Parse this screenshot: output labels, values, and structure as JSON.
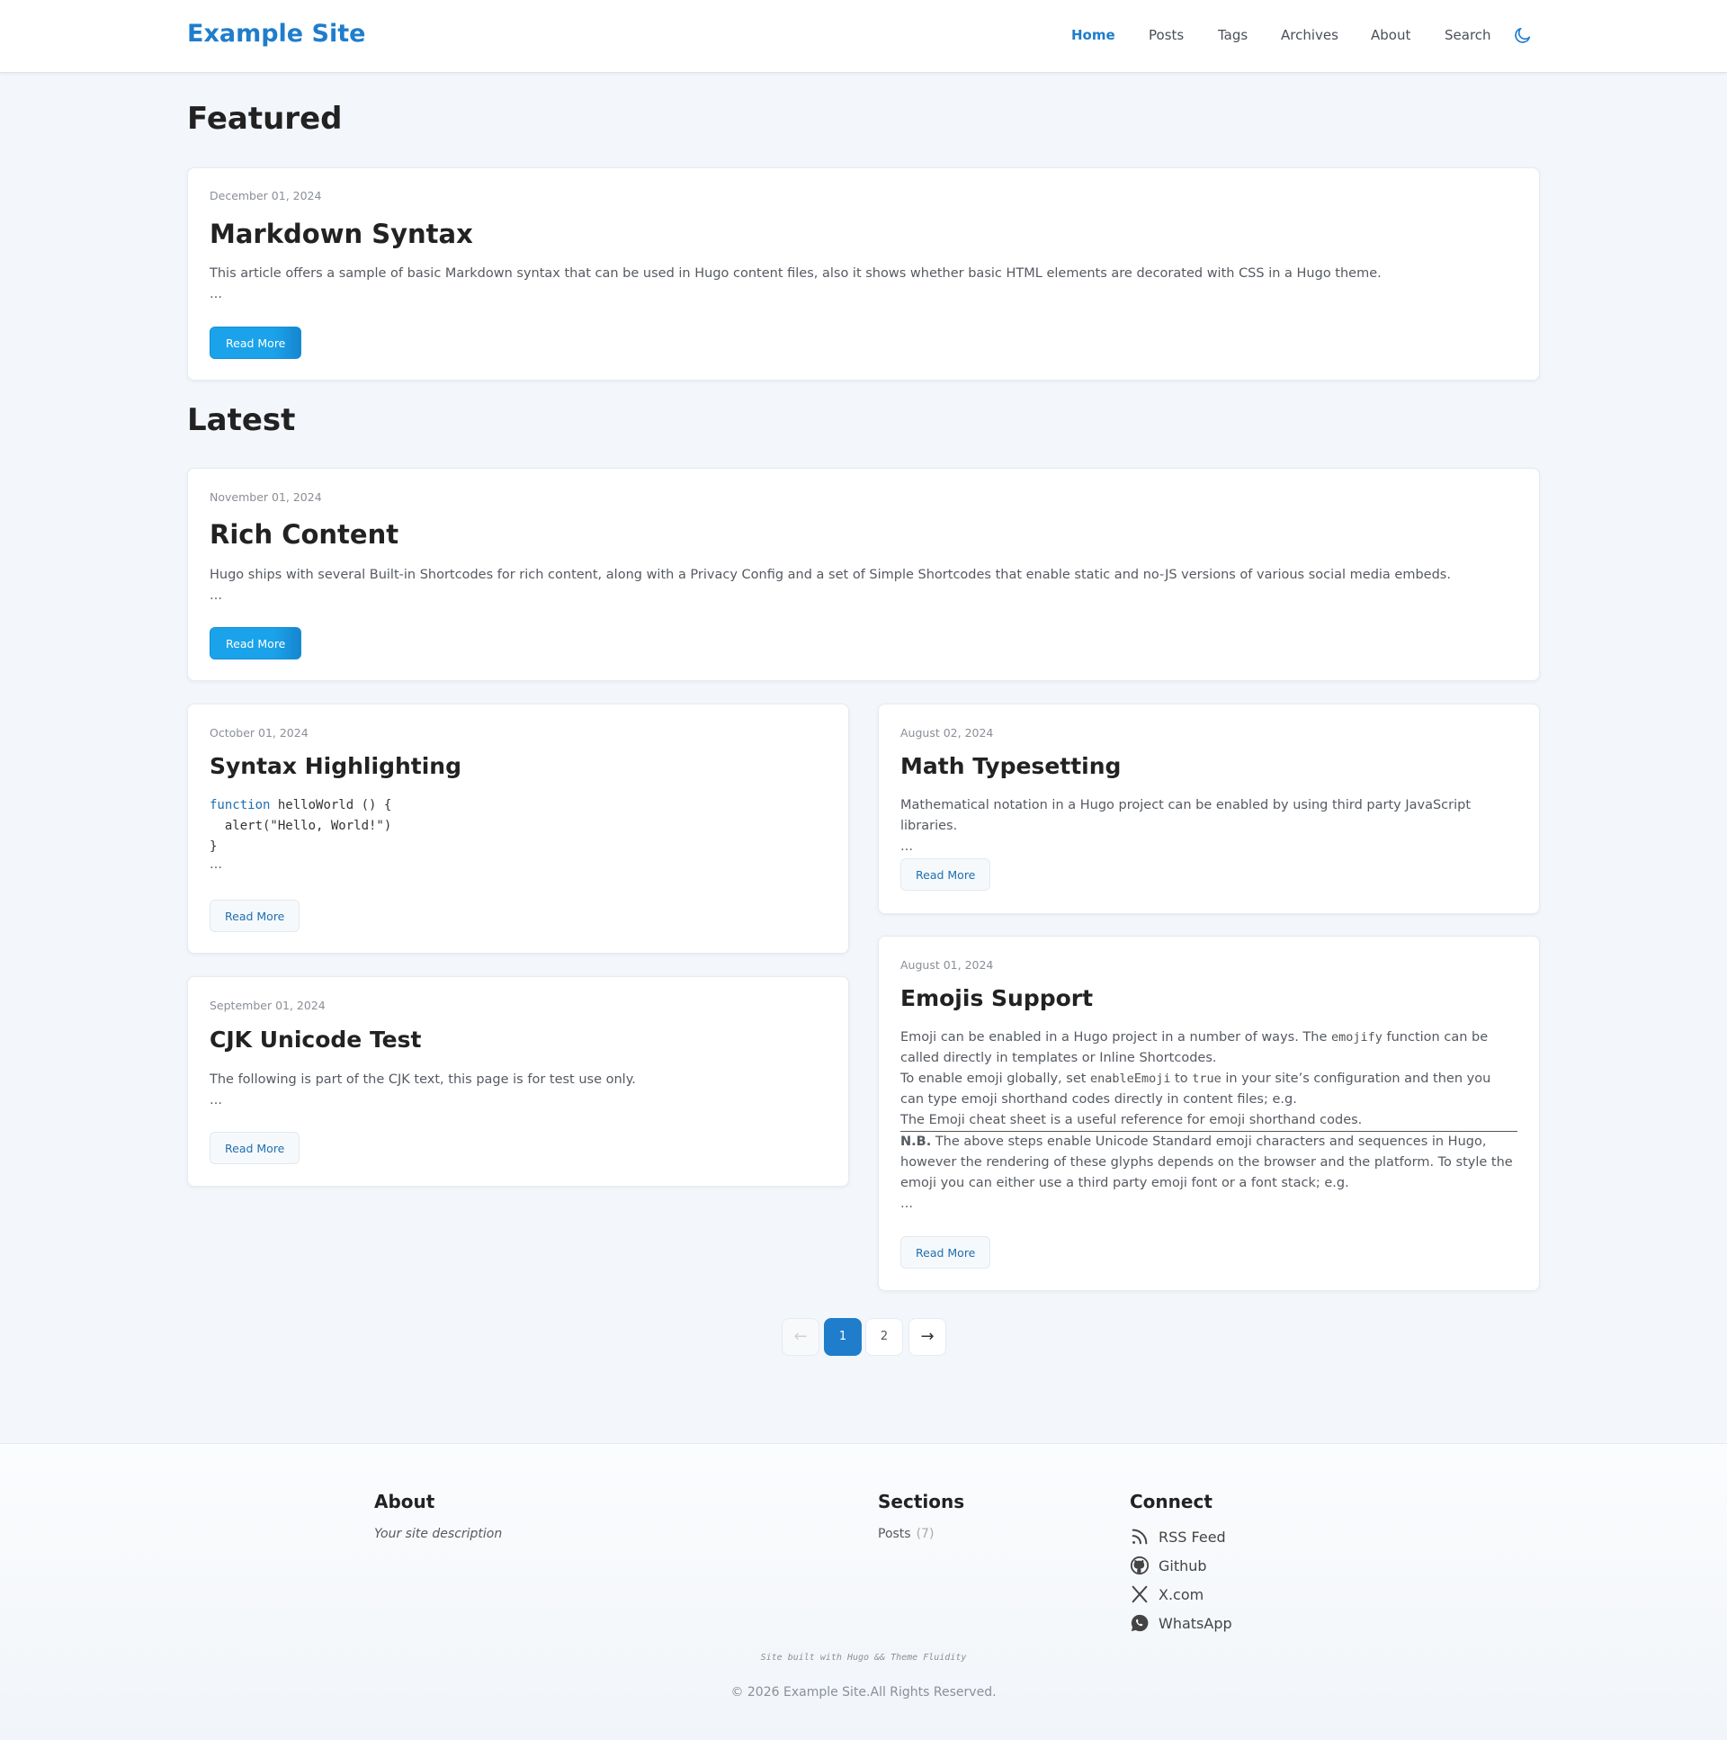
{
  "site": {
    "logo": "Example Site"
  },
  "nav": {
    "items": [
      "Home",
      "Posts",
      "Tags",
      "Archives",
      "About",
      "Search"
    ],
    "theme_icon": "moon-icon"
  },
  "sections": {
    "featured": "Featured",
    "latest": "Latest"
  },
  "posts": [
    {
      "date": "December 01, 2024",
      "title": "Markdown Syntax",
      "excerpt": "This article offers a sample of basic Markdown syntax that can be used in Hugo content files, also it shows whether basic HTML elements are decorated with CSS in a Hugo theme.",
      "ellipsis": "…",
      "button": "Read More"
    },
    {
      "date": "November 01, 2024",
      "title": "Rich Content",
      "excerpt": "Hugo ships with several Built-in Shortcodes for rich content, along with a Privacy Config and a set of Simple Shortcodes that enable static and no-JS versions of various social media embeds.",
      "ellipsis": "…",
      "button": "Read More"
    },
    {
      "date": "October 01, 2024",
      "title": "Syntax Highlighting",
      "code_keyword": "function",
      "code_line1_rest": " helloWorld () {",
      "code_line2": "  alert(\"Hello, World!\")",
      "code_line3": "}",
      "ellipsis": "…",
      "button": "Read More"
    },
    {
      "date": "August 02, 2024",
      "title": "Math Typesetting",
      "excerpt": "Mathematical notation in a Hugo project can be enabled by using third party JavaScript libraries.",
      "ellipsis": "…",
      "button": "Read More"
    },
    {
      "date": "September 01, 2024",
      "title": "CJK Unicode Test",
      "excerpt": "The following is part of the CJK text, this page is for test use only.",
      "ellipsis": "…",
      "button": "Read More"
    },
    {
      "date": "August 01, 2024",
      "title": "Emojis Support",
      "p1_a": "Emoji can be enabled in a Hugo project in a number of ways. The ",
      "p1_code": "emojify",
      "p1_b": " function can be called directly in templates or Inline Shortcodes.",
      "p2_a": "To enable emoji globally, set ",
      "p2_code1": "enableEmoji",
      "p2_b": " to ",
      "p2_code2": "true",
      "p2_c": " in your site’s configuration and then you can type emoji shorthand codes directly in content files; e.g.",
      "p3": "The Emoji cheat sheet is a useful reference for emoji shorthand codes.",
      "p4_bold": "N.B.",
      "p4_rest": " The above steps enable Unicode Standard emoji characters and sequences in Hugo, however the rendering of these glyphs depends on the browser and the platform. To style the emoji you can either use a third party emoji font or a font stack; e.g.",
      "ellipsis": "…",
      "button": "Read More"
    }
  ],
  "pagination": {
    "prev": "←",
    "pages": [
      "1",
      "2"
    ],
    "current": "1",
    "next": "→"
  },
  "footer": {
    "about_heading": "About",
    "about_desc": "Your site description",
    "sections_heading": "Sections",
    "sections_item": "Posts",
    "sections_count": "(7)",
    "connect_heading": "Connect",
    "links": [
      {
        "label": "RSS Feed",
        "icon": "rss-icon"
      },
      {
        "label": "Github",
        "icon": "github-icon"
      },
      {
        "label": "X.com",
        "icon": "x-icon"
      },
      {
        "label": "WhatsApp",
        "icon": "whatsapp-icon"
      }
    ],
    "built_with": "Site built with Hugo && Theme Fluidity",
    "copyright": "© 2026 Example Site.All Rights Reserved."
  }
}
